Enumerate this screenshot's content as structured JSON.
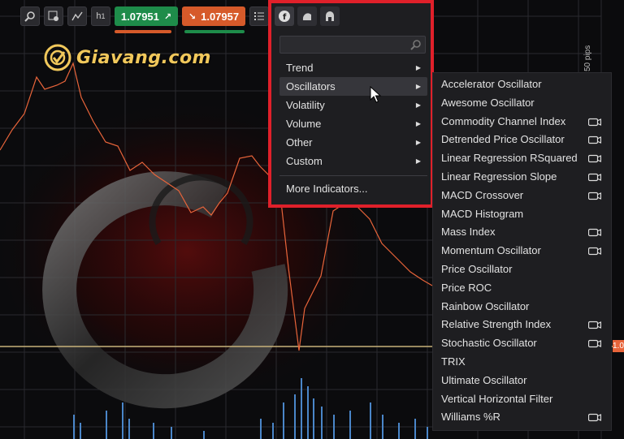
{
  "toolbar": {
    "buttons": [
      {
        "name": "zoom-icon"
      },
      {
        "name": "crosshair-settings-icon"
      },
      {
        "name": "chart-type-icon"
      },
      {
        "name": "timeframe-button",
        "label": "h 1"
      },
      {
        "name": "indicators-list-icon"
      }
    ],
    "timeframe_label": "h",
    "timeframe_sub": "1",
    "buy_price": "1.07951",
    "sell_price": "1.07957",
    "buy_color": "#1e8c4a",
    "sell_color": "#d65a2a"
  },
  "logo": {
    "text": "Giavang.com"
  },
  "axis": {
    "pips_label": "50 pips",
    "tick": "1.",
    "price_tag": "1.0"
  },
  "indicator_panel": {
    "tabs": [
      "f-indicator-icon",
      "fingerprint-icon",
      "signal-icon"
    ],
    "search_placeholder": "",
    "menu": [
      {
        "label": "Trend",
        "has_submenu": true
      },
      {
        "label": "Oscillators",
        "has_submenu": true,
        "hover": true
      },
      {
        "label": "Volatility",
        "has_submenu": true
      },
      {
        "label": "Volume",
        "has_submenu": true
      },
      {
        "label": "Other",
        "has_submenu": true
      },
      {
        "label": "Custom",
        "has_submenu": true
      }
    ],
    "more_label": "More Indicators..."
  },
  "oscillators_submenu": [
    {
      "label": "Accelerator Oscillator",
      "cloud": false
    },
    {
      "label": "Awesome Oscillator",
      "cloud": false
    },
    {
      "label": "Commodity Channel Index",
      "cloud": true
    },
    {
      "label": "Detrended Price Oscillator",
      "cloud": true
    },
    {
      "label": "Linear Regression RSquared",
      "cloud": true
    },
    {
      "label": "Linear Regression Slope",
      "cloud": true
    },
    {
      "label": "MACD Crossover",
      "cloud": true
    },
    {
      "label": "MACD Histogram",
      "cloud": false
    },
    {
      "label": "Mass Index",
      "cloud": true
    },
    {
      "label": "Momentum Oscillator",
      "cloud": true
    },
    {
      "label": "Price Oscillator",
      "cloud": false
    },
    {
      "label": "Price ROC",
      "cloud": false
    },
    {
      "label": "Rainbow Oscillator",
      "cloud": false
    },
    {
      "label": "Relative Strength Index",
      "cloud": true
    },
    {
      "label": "Stochastic Oscillator",
      "cloud": true
    },
    {
      "label": "TRIX",
      "cloud": false
    },
    {
      "label": "Ultimate Oscillator",
      "cloud": false
    },
    {
      "label": "Vertical Horizontal Filter",
      "cloud": false
    },
    {
      "label": "Williams %R",
      "cloud": true
    }
  ],
  "colors": {
    "highlight": "#e0202a",
    "price_line": "#e8643a",
    "volume": "#4a86c9",
    "level_line": "#c8b27a"
  }
}
